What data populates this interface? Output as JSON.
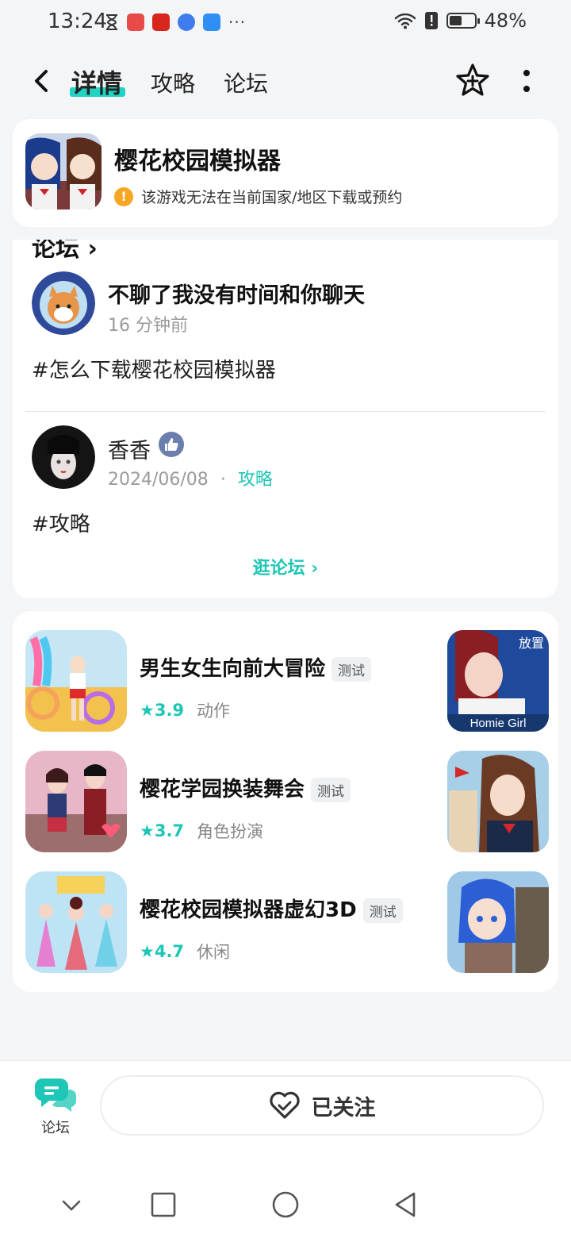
{
  "status_bar": {
    "time": "13:24",
    "battery": "48%",
    "more": "···"
  },
  "header": {
    "tabs": [
      {
        "label": "详情",
        "active": true
      },
      {
        "label": "攻略",
        "active": false
      },
      {
        "label": "论坛",
        "active": false
      }
    ]
  },
  "game": {
    "title": "樱花校园模拟器",
    "notice": "该游戏无法在当前国家/地区下载或预约",
    "notice_icon": "!"
  },
  "forum": {
    "heading": "论坛 ›",
    "posts": [
      {
        "author": "不聊了我没有时间和你聊天",
        "time": "16 分钟前",
        "body": "#怎么下载樱花校园模拟器"
      },
      {
        "author": "香香",
        "time": "2024/06/08",
        "dot": "·",
        "tag": "攻略",
        "body": "#攻略"
      }
    ],
    "browse_label": "逛论坛 ›"
  },
  "recommendations": [
    {
      "title": "男生女生向前大冒险",
      "badge": "测试",
      "score": "★3.9",
      "genre": "动作",
      "thumb_text": "Homie Girl",
      "thumb_corner": "放置"
    },
    {
      "title": "樱花学园换装舞会",
      "badge": "测试",
      "score": "★3.7",
      "genre": "角色扮演"
    },
    {
      "title": "樱花校园模拟器虚幻3D",
      "badge": "测试",
      "score": "★4.7",
      "genre": "休闲"
    }
  ],
  "bottom_bar": {
    "forum_label": "论坛",
    "follow_label": "已关注"
  },
  "colors": {
    "accent": "#1ec6b6",
    "tab_underline": "#20d3c2",
    "warning": "#f5a623",
    "like": "#6a7fae"
  }
}
